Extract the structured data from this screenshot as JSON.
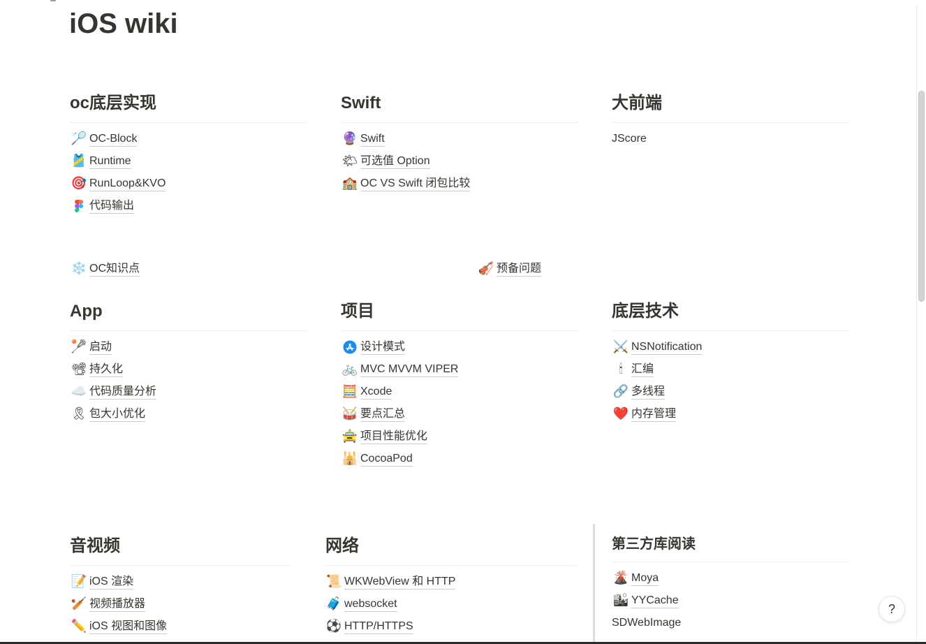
{
  "page": {
    "title": "iOS wiki"
  },
  "colors": {
    "text": "#37352f",
    "app_store_blue": "#1a8cf0"
  },
  "sections": [
    {
      "heading": "oc底层实现",
      "items": [
        {
          "icon": "🏸",
          "icon_name": "badminton-icon",
          "label": "OC-Block"
        },
        {
          "icon": "🎽",
          "icon_name": "running-shirt-icon",
          "label": "Runtime"
        },
        {
          "icon": "🎯",
          "icon_name": "target-icon",
          "label": "RunLoop&KVO"
        },
        {
          "icon_name": "figma-icon",
          "label": "代码输出"
        }
      ]
    },
    {
      "heading": "Swift",
      "items": [
        {
          "icon": "🔮",
          "icon_name": "crystal-ball-icon",
          "label": "Swift"
        },
        {
          "icon": "🌤",
          "icon_name": "sun-behind-cloud-icon",
          "label": "可选值 Option"
        },
        {
          "icon": "🏫",
          "icon_name": "school-icon",
          "label": "OC VS Swift 闭包比较"
        }
      ]
    },
    {
      "heading": "大前端",
      "items": [
        {
          "label": "JScore"
        }
      ]
    },
    {
      "heading": "App",
      "items": [
        {
          "icon": "🥍",
          "icon_name": "lacrosse-icon",
          "label": "启动"
        },
        {
          "icon": "📽",
          "icon_name": "film-projector-icon",
          "label": "持久化"
        },
        {
          "icon": "☁️",
          "icon_name": "cloud-icon",
          "label": "代码质量分析"
        },
        {
          "icon": "🎗",
          "icon_name": "reminder-ribbon-icon",
          "label": "包大小优化"
        }
      ]
    },
    {
      "heading": "项目",
      "items": [
        {
          "icon_name": "app-store-icon",
          "label": "设计模式"
        },
        {
          "icon": "🚲",
          "icon_name": "bicycle-icon",
          "label": "MVC MVVM VIPER"
        },
        {
          "icon": "🧮",
          "icon_name": "abacus-icon",
          "label": "Xcode"
        },
        {
          "icon": "🥁",
          "icon_name": "drum-icon",
          "label": "要点汇总"
        },
        {
          "icon": "🚖",
          "icon_name": "taxi-icon",
          "label": "项目性能优化"
        },
        {
          "icon": "🕌",
          "icon_name": "mosque-icon",
          "label": "CocoaPod"
        }
      ]
    },
    {
      "heading": "底层技术",
      "items": [
        {
          "icon": "⚔️",
          "icon_name": "crossed-swords-icon",
          "label": "NSNotification"
        },
        {
          "icon": "🕯",
          "icon_name": "candle-icon",
          "label": "汇编"
        },
        {
          "icon": "🔗",
          "icon_name": "link-icon",
          "label": "多线程"
        },
        {
          "icon": "❤️",
          "icon_name": "heart-icon",
          "label": "内存管理"
        }
      ]
    },
    {
      "heading": "音视频",
      "items": [
        {
          "icon": "📝",
          "icon_name": "memo-icon",
          "label": "iOS 渲染"
        },
        {
          "icon": "🏏",
          "icon_name": "cricket-icon",
          "label": "视频播放器"
        },
        {
          "icon": "✏️",
          "icon_name": "pencil-icon",
          "label": "iOS 视图和图像"
        }
      ]
    },
    {
      "heading": "网络",
      "items": [
        {
          "icon": "📜",
          "icon_name": "scroll-icon",
          "label": "WKWebView 和 HTTP"
        },
        {
          "icon": "🧳",
          "icon_name": "luggage-icon",
          "label": "websocket"
        },
        {
          "icon": "⚽",
          "icon_name": "soccer-ball-icon",
          "label": "HTTP/HTTPS"
        }
      ]
    },
    {
      "heading": "第三方库阅读",
      "items": [
        {
          "icon": "🌋",
          "icon_name": "volcano-icon",
          "label": "Moya"
        },
        {
          "icon": "🏙",
          "icon_name": "cityscape-icon",
          "label": "YYCache"
        },
        {
          "label": "SDWebImage"
        }
      ]
    }
  ],
  "loose_links": [
    {
      "icon": "❄️",
      "icon_name": "snowflake-icon",
      "label": "OC知识点"
    },
    {
      "icon": "🎻",
      "icon_name": "violin-icon",
      "label": "预备问题"
    }
  ],
  "help": {
    "label": "?"
  }
}
